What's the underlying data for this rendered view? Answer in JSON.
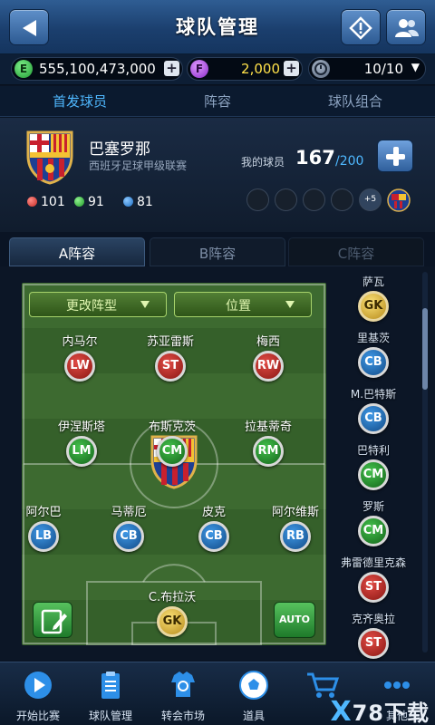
{
  "header": {
    "title": "球队管理",
    "back_icon": "back-arrow-icon",
    "alert_icon": "exclamation-icon",
    "friends_icon": "people-icon"
  },
  "currency": {
    "e_coin": {
      "icon": "E",
      "value": "555,100,473,000",
      "color": "#22a33a"
    },
    "f_coin": {
      "icon": "F",
      "value": "2,000",
      "color": "#9b32d8"
    },
    "energy": {
      "icon": "timer-icon",
      "value": "10/10"
    }
  },
  "main_tabs": [
    {
      "label": "首发球员",
      "active": true
    },
    {
      "label": "阵容",
      "active": false
    },
    {
      "label": "球队组合",
      "active": false
    }
  ],
  "club": {
    "name": "巴塞罗那",
    "league": "西班牙足球甲级联赛",
    "my_players_label": "我的球员",
    "my_players_count": "167",
    "my_players_max": "/200",
    "stats": [
      {
        "color": "#e8423c",
        "value": "101"
      },
      {
        "color": "#31c23a",
        "value": "91"
      },
      {
        "color": "#2d8fe8",
        "value": "81"
      }
    ],
    "combo_slots_more": "+5"
  },
  "lineup_tabs": [
    {
      "label": "A阵容",
      "active": true
    },
    {
      "label": "B阵容",
      "active": false
    },
    {
      "label": "C阵容",
      "active": false
    }
  ],
  "pitch": {
    "formation_button": "更改阵型",
    "position_button": "位置",
    "auto_button": "AUTO",
    "players": [
      {
        "name": "内马尔",
        "pos": "LW",
        "color": "red"
      },
      {
        "name": "苏亚雷斯",
        "pos": "ST",
        "color": "red"
      },
      {
        "name": "梅西",
        "pos": "RW",
        "color": "red"
      },
      {
        "name": "伊涅斯塔",
        "pos": "LM",
        "color": "green"
      },
      {
        "name": "布斯克茨",
        "pos": "CM",
        "color": "green"
      },
      {
        "name": "拉基蒂奇",
        "pos": "RM",
        "color": "green"
      },
      {
        "name": "阿尔巴",
        "pos": "LB",
        "color": "blue"
      },
      {
        "name": "马蒂厄",
        "pos": "CB",
        "color": "blue"
      },
      {
        "name": "皮克",
        "pos": "CB",
        "color": "blue"
      },
      {
        "name": "阿尔维斯",
        "pos": "RB",
        "color": "blue"
      },
      {
        "name": "C.布拉沃",
        "pos": "GK",
        "color": "gold"
      }
    ]
  },
  "bench": [
    {
      "name": "萨瓦",
      "pos": "GK",
      "color": "gold"
    },
    {
      "name": "里基茨",
      "pos": "CB",
      "color": "blue"
    },
    {
      "name": "M.巴特斯",
      "pos": "CB",
      "color": "blue"
    },
    {
      "name": "巴特利",
      "pos": "CM",
      "color": "green"
    },
    {
      "name": "罗斯",
      "pos": "CM",
      "color": "green"
    },
    {
      "name": "弗雷德里克森",
      "pos": "ST",
      "color": "red"
    },
    {
      "name": "克齐奥拉",
      "pos": "ST",
      "color": "red"
    }
  ],
  "bottom_nav": [
    {
      "label": "开始比赛",
      "icon": "play-icon"
    },
    {
      "label": "球队管理",
      "icon": "clipboard-icon"
    },
    {
      "label": "转会市场",
      "icon": "transfer-icon"
    },
    {
      "label": "道具",
      "icon": "ball-icon"
    },
    {
      "label": "",
      "icon": "cart-icon"
    },
    {
      "label": "其他",
      "icon": "more-icon"
    }
  ],
  "watermark": {
    "mark": "X",
    "text": "78下载"
  }
}
